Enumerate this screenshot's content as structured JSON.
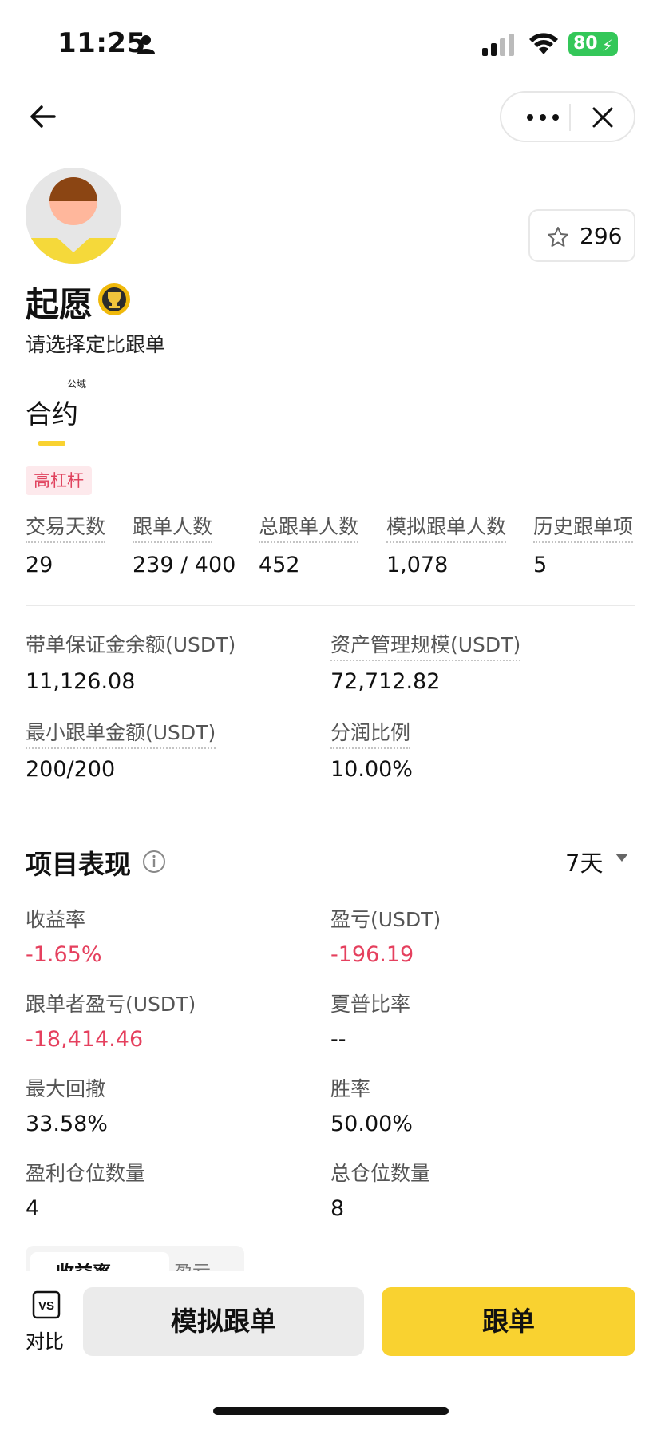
{
  "status_bar": {
    "time": "11:25",
    "battery": "80"
  },
  "header": {
    "favorites_count": "296"
  },
  "profile": {
    "name": "起愿",
    "subtitle": "请选择定比跟单"
  },
  "tab": {
    "superscript": "公域",
    "label": "合约"
  },
  "tag": "高杠杆",
  "stats_row": [
    {
      "label": "交易天数",
      "value": "29"
    },
    {
      "label": "跟单人数",
      "value": "239 / 400"
    },
    {
      "label": "总跟单人数",
      "value": "452"
    },
    {
      "label": "模拟跟单人数",
      "value": "1,078"
    },
    {
      "label": "历史跟单项",
      "value": "5"
    }
  ],
  "details": [
    {
      "label": "带单保证金余额(USDT)",
      "value": "11,126.08"
    },
    {
      "label": "资产管理规模(USDT)",
      "value": "72,712.82"
    },
    {
      "label": "最小跟单金额(USDT)",
      "value": "200/200"
    },
    {
      "label": "分润比例",
      "value": "10.00%"
    }
  ],
  "performance": {
    "title": "项目表现",
    "period": "7天",
    "metrics": [
      {
        "label": "收益率",
        "value": "-1.65%"
      },
      {
        "label": "盈亏(USDT)",
        "value": "-196.19"
      },
      {
        "label": "跟单者盈亏(USDT)",
        "value": "-18,414.46"
      },
      {
        "label": "夏普比率",
        "value": "--"
      },
      {
        "label": "最大回撤",
        "value": "33.58%"
      },
      {
        "label": "胜率",
        "value": "50.00%"
      },
      {
        "label": "盈利仓位数量",
        "value": "4"
      },
      {
        "label": "总仓位数量",
        "value": "8"
      }
    ],
    "mini_tabs": [
      "收益率",
      "盈亏"
    ]
  },
  "bottom": {
    "compare_icon_text": "VS",
    "compare_label": "对比",
    "simulate_label": "模拟跟单",
    "follow_label": "跟单"
  },
  "colors": {
    "accent": "#f9d230",
    "negative": "#e5405e",
    "battery": "#34c759"
  }
}
